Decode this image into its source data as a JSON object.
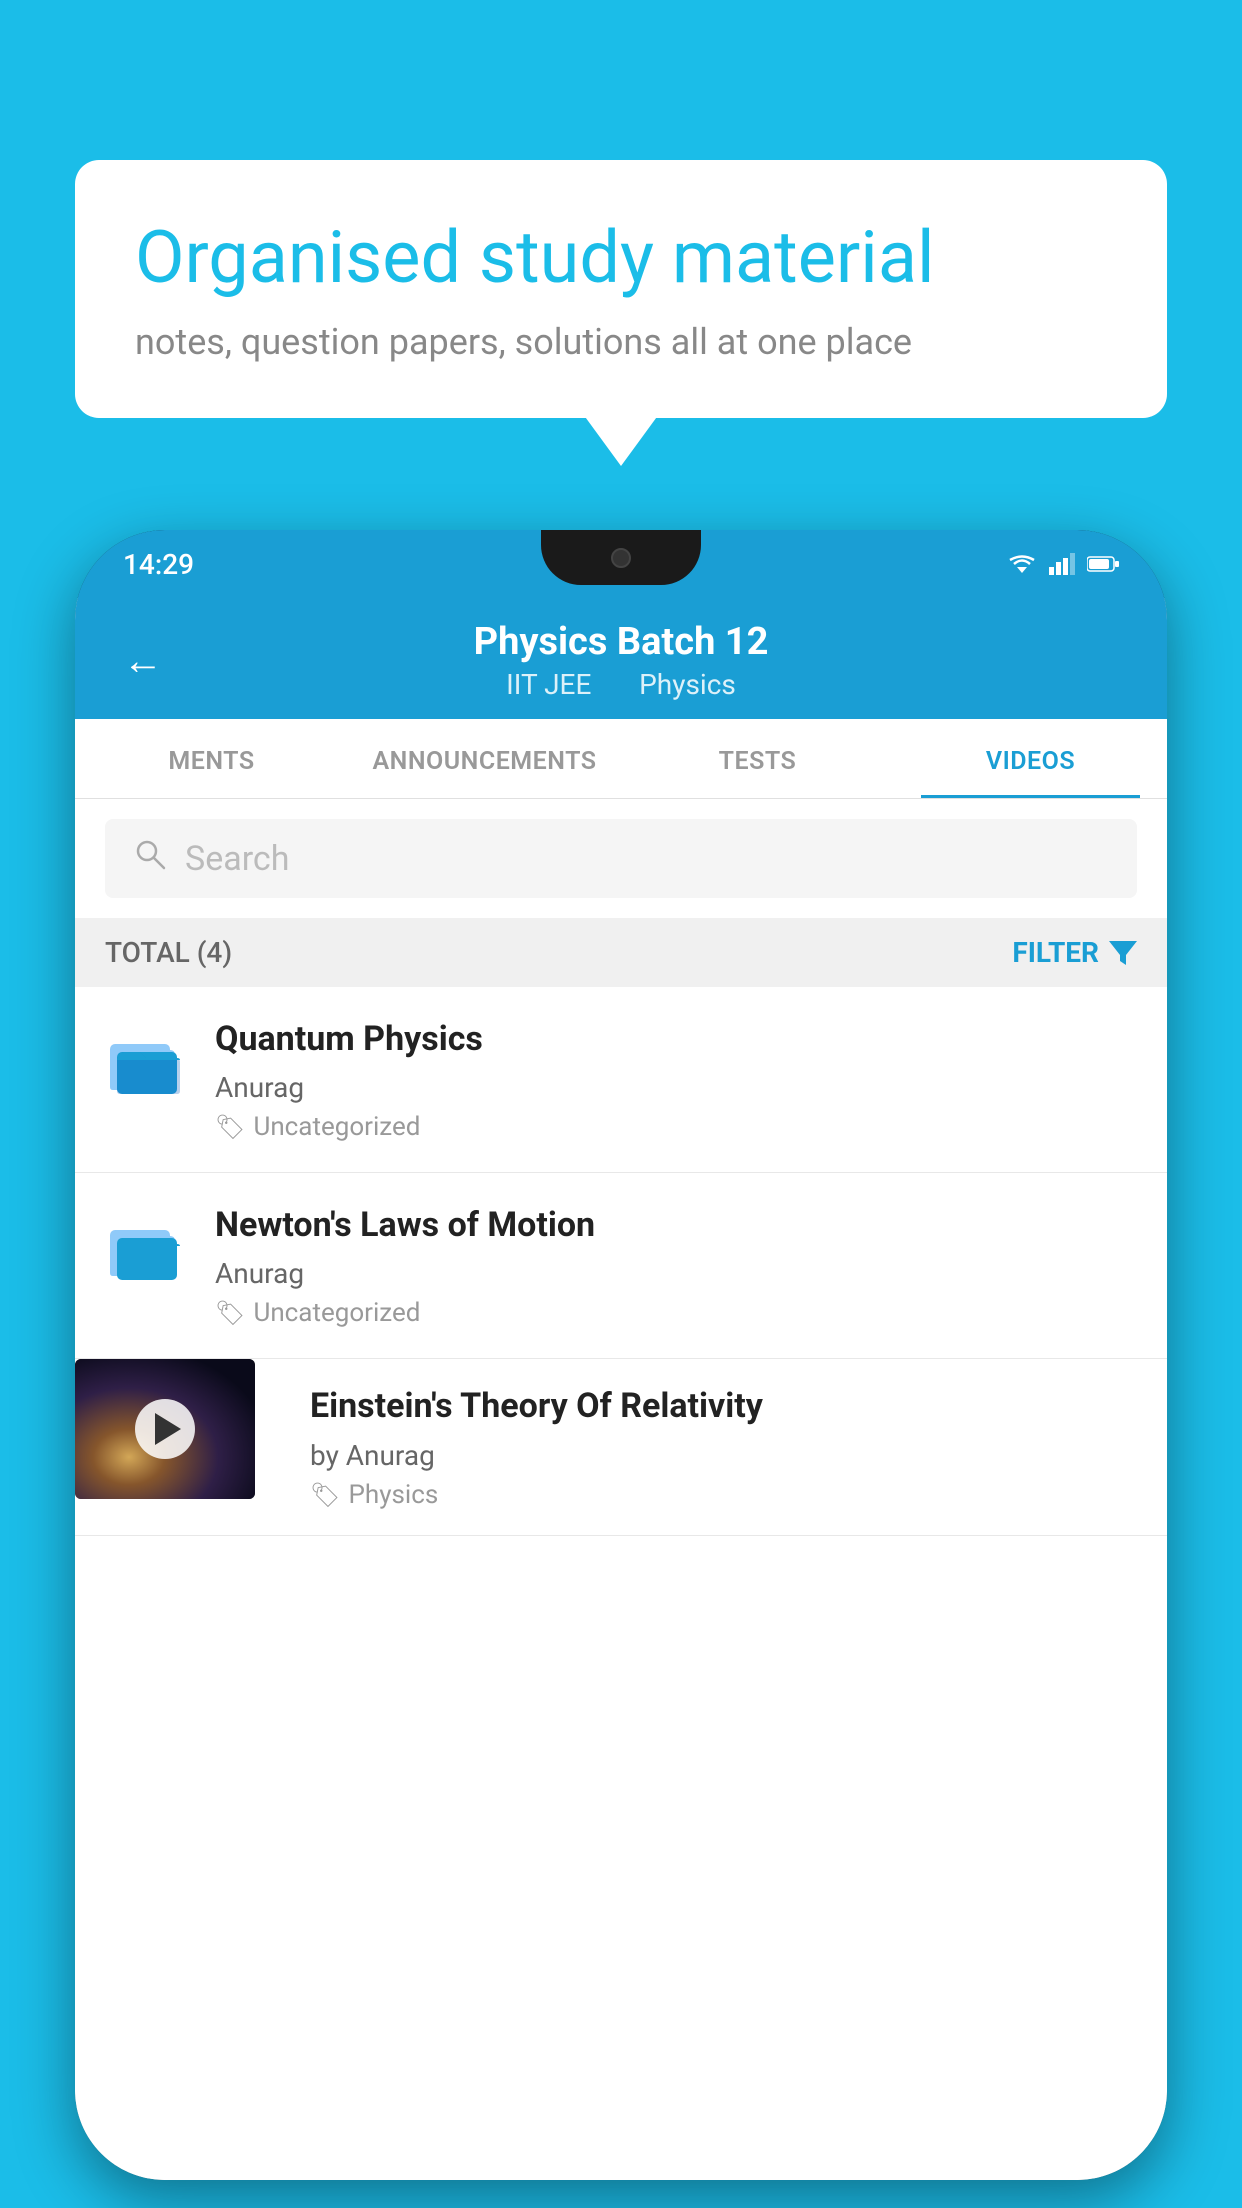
{
  "page": {
    "background_color": "#1bbde8"
  },
  "speech_bubble": {
    "title": "Organised study material",
    "subtitle": "notes, question papers, solutions all at one place"
  },
  "phone": {
    "status_bar": {
      "time": "14:29"
    },
    "app_header": {
      "title": "Physics Batch 12",
      "subtitle_parts": [
        "IIT JEE",
        "Physics"
      ],
      "back_label": "←"
    },
    "tabs": [
      {
        "label": "MENTS",
        "active": false
      },
      {
        "label": "ANNOUNCEMENTS",
        "active": false
      },
      {
        "label": "TESTS",
        "active": false
      },
      {
        "label": "VIDEOS",
        "active": true
      }
    ],
    "search": {
      "placeholder": "Search"
    },
    "filter_bar": {
      "total_label": "TOTAL (4)",
      "filter_label": "FILTER"
    },
    "videos": [
      {
        "id": 1,
        "title": "Quantum Physics",
        "author": "Anurag",
        "tag": "Uncategorized",
        "has_thumb": false
      },
      {
        "id": 2,
        "title": "Newton's Laws of Motion",
        "author": "Anurag",
        "tag": "Uncategorized",
        "has_thumb": false
      },
      {
        "id": 3,
        "title": "Einstein's Theory Of Relativity",
        "author": "by Anurag",
        "tag": "Physics",
        "has_thumb": true
      }
    ]
  }
}
